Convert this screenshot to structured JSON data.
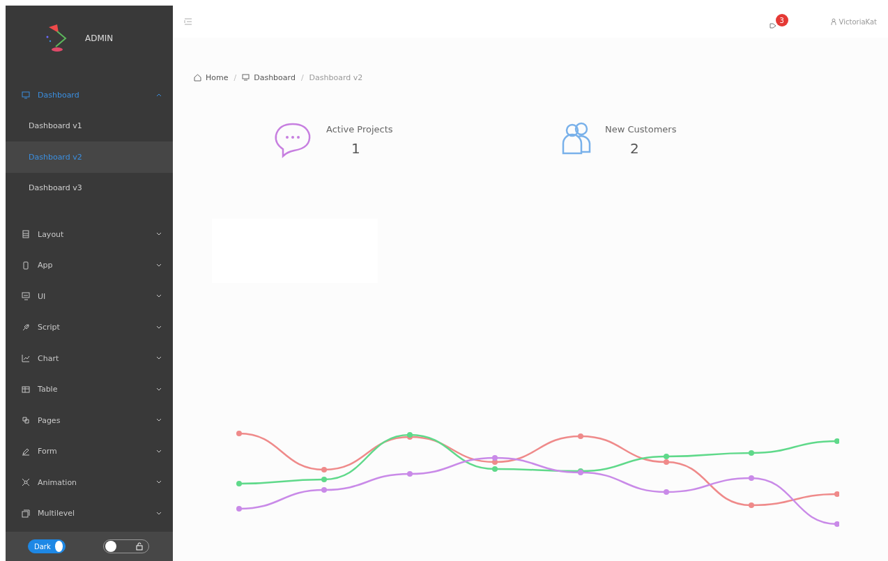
{
  "sidebar": {
    "logo_text": "ADMIN",
    "items": [
      {
        "label": "Dashboard",
        "expanded": true,
        "selected": true,
        "children": [
          {
            "label": "Dashboard v1",
            "selected": false
          },
          {
            "label": "Dashboard v2",
            "selected": true
          },
          {
            "label": "Dashboard v3",
            "selected": false
          }
        ]
      },
      {
        "label": "Layout",
        "expanded": false,
        "selected": false
      },
      {
        "label": "App",
        "expanded": false,
        "selected": false
      },
      {
        "label": "UI",
        "expanded": false,
        "selected": false
      },
      {
        "label": "Script",
        "expanded": false,
        "selected": false
      },
      {
        "label": "Chart",
        "expanded": false,
        "selected": false
      },
      {
        "label": "Table",
        "expanded": false,
        "selected": false
      },
      {
        "label": "Pages",
        "expanded": false,
        "selected": false
      },
      {
        "label": "Form",
        "expanded": false,
        "selected": false
      },
      {
        "label": "Animation",
        "expanded": false,
        "selected": false
      },
      {
        "label": "Multilevel",
        "expanded": false,
        "selected": false
      }
    ],
    "theme_toggle": {
      "label": "Dark",
      "on": true
    },
    "lock_toggle": {
      "on": false
    }
  },
  "topbar": {
    "notification_count": "3",
    "user": "VictoriaKat"
  },
  "breadcrumb": [
    {
      "label": "Home"
    },
    {
      "separator": "/"
    },
    {
      "label": "Dashboard"
    },
    {
      "separator": "/"
    },
    {
      "label": "Dashboard v2"
    }
  ],
  "stats": [
    {
      "label": "Active Projects",
      "value": "1"
    },
    {
      "label": "New Customers",
      "value": "2"
    }
  ]
}
